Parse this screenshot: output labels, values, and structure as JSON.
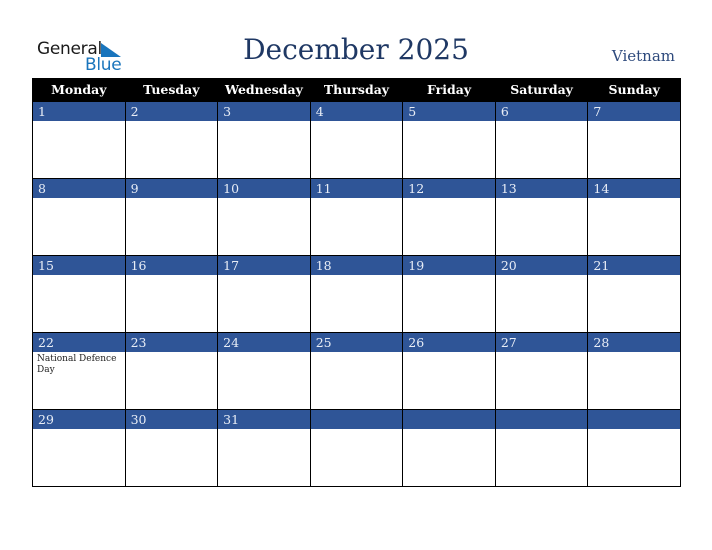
{
  "brand": {
    "line1": "General",
    "line2": "Blue",
    "color": "#1a75bc"
  },
  "title": "December 2025",
  "country": "Vietnam",
  "colors": {
    "header_bg": "#000000",
    "day_bar": "#2f5597",
    "title": "#1f3864"
  },
  "weekdays": [
    "Monday",
    "Tuesday",
    "Wednesday",
    "Thursday",
    "Friday",
    "Saturday",
    "Sunday"
  ],
  "weeks": [
    [
      {
        "day": "1",
        "event": ""
      },
      {
        "day": "2",
        "event": ""
      },
      {
        "day": "3",
        "event": ""
      },
      {
        "day": "4",
        "event": ""
      },
      {
        "day": "5",
        "event": ""
      },
      {
        "day": "6",
        "event": ""
      },
      {
        "day": "7",
        "event": ""
      }
    ],
    [
      {
        "day": "8",
        "event": ""
      },
      {
        "day": "9",
        "event": ""
      },
      {
        "day": "10",
        "event": ""
      },
      {
        "day": "11",
        "event": ""
      },
      {
        "day": "12",
        "event": ""
      },
      {
        "day": "13",
        "event": ""
      },
      {
        "day": "14",
        "event": ""
      }
    ],
    [
      {
        "day": "15",
        "event": ""
      },
      {
        "day": "16",
        "event": ""
      },
      {
        "day": "17",
        "event": ""
      },
      {
        "day": "18",
        "event": ""
      },
      {
        "day": "19",
        "event": ""
      },
      {
        "day": "20",
        "event": ""
      },
      {
        "day": "21",
        "event": ""
      }
    ],
    [
      {
        "day": "22",
        "event": "National Defence Day"
      },
      {
        "day": "23",
        "event": ""
      },
      {
        "day": "24",
        "event": ""
      },
      {
        "day": "25",
        "event": ""
      },
      {
        "day": "26",
        "event": ""
      },
      {
        "day": "27",
        "event": ""
      },
      {
        "day": "28",
        "event": ""
      }
    ],
    [
      {
        "day": "29",
        "event": ""
      },
      {
        "day": "30",
        "event": ""
      },
      {
        "day": "31",
        "event": ""
      },
      {
        "day": "",
        "event": ""
      },
      {
        "day": "",
        "event": ""
      },
      {
        "day": "",
        "event": ""
      },
      {
        "day": "",
        "event": ""
      }
    ]
  ]
}
